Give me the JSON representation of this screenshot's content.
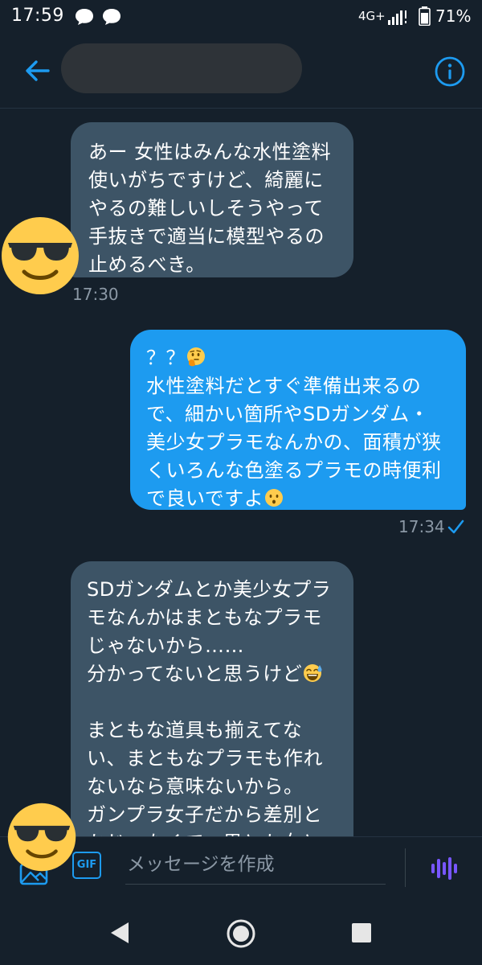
{
  "status_bar": {
    "time": "17:59",
    "network": "4G+",
    "battery": "71%"
  },
  "header": {
    "contact_name": "",
    "back_icon": "arrow-left-icon",
    "info_icon": "info-icon"
  },
  "messages": [
    {
      "direction": "received",
      "lines": [
        "あー 女性はみんな水性塗料",
        "使いがちですけど、綺麗に",
        "やるの難しいしそうやって",
        "手抜きで適当に模型やるの",
        "止めるべき。"
      ],
      "time": "17:30"
    },
    {
      "direction": "sent",
      "prefix": "？？",
      "prefix_emoji": "thinking-face",
      "lines": [
        "水性塗料だとすぐ準備出来るの",
        "で、細かい箇所やSDガンダム・",
        "美少女プラモなんかの、面積が狭",
        "くいろんな色塗るプラモの時便利",
        "で良いですよ"
      ],
      "suffix_emoji": "kissing-face",
      "time": "17:34",
      "status": "read"
    },
    {
      "direction": "received",
      "lines": [
        "SDガンダムとか美少女プラ",
        "モなんかはまともなプラモ",
        "じゃないから……",
        "分かってないと思うけど",
        "",
        "まともな道具も揃えてな",
        "い、まともなプラモも作れ",
        "ないなら意味ないから。",
        "ガンプラ女子だから差別と",
        "かじゃなくて、男とか女と"
      ],
      "emoji_after_line_4": "sweat-smile-face"
    }
  ],
  "compose": {
    "placeholder": "メッセージを作成",
    "gif_label": "GIF",
    "image_icon": "image-icon",
    "voice_icon": "voice-icon"
  },
  "nav": {
    "back_icon": "nav-back-icon",
    "home_icon": "nav-home-icon",
    "recents_icon": "nav-recents-icon"
  },
  "colors": {
    "background": "#15202b",
    "received_bubble": "#3d5466",
    "sent_bubble": "#1d9bf0",
    "accent": "#1d9bf0",
    "secondary_text": "#8b98a5",
    "voice": "#7856ff"
  }
}
